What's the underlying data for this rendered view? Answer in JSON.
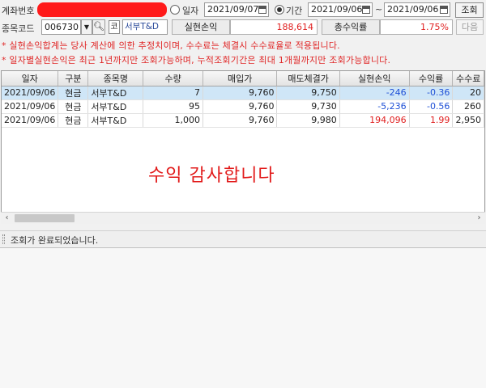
{
  "header": {
    "account_label": "계좌번호",
    "radio_daily_label": "일자",
    "daily_date": "2021/09/07",
    "radio_period_label": "기간",
    "period_from": "2021/09/06",
    "period_sep": "~",
    "period_to": "2021/09/06",
    "query_button": "조회"
  },
  "stock": {
    "code_label": "종목코드",
    "code_value": "006730",
    "market_badge": "코",
    "name_value": "서부T&D",
    "realized_label": "실현손익",
    "realized_value": "188,614",
    "total_return_label": "총수익률",
    "total_return_value": "1.75%",
    "next_button": "다음"
  },
  "notices": [
    "* 실현손익합계는 당사 계산에 의한 추정치이며, 수수료는 체결시 수수료율로 적용됩니다.",
    "* 일자별실현손익은 최근 1년까지만 조회가능하며, 누적조회기간은 최대 1개월까지만 조회가능합니다."
  ],
  "table": {
    "columns": [
      "일자",
      "구분",
      "종목명",
      "수량",
      "매입가",
      "매도체결가",
      "실현손익",
      "수익률",
      "수수료"
    ],
    "rows": [
      [
        "2021/09/06",
        "현금",
        "서부T&D",
        "7",
        "9,760",
        "9,750",
        "-246",
        "-0.36",
        "20"
      ],
      [
        "2021/09/06",
        "현금",
        "서부T&D",
        "95",
        "9,760",
        "9,730",
        "-5,236",
        "-0.56",
        "260"
      ],
      [
        "2021/09/06",
        "현금",
        "서부T&D",
        "1,000",
        "9,760",
        "9,980",
        "194,096",
        "1.99",
        "2,950"
      ]
    ]
  },
  "overlay_message": "수익 감사합니다",
  "status": {
    "text": "조회가 완료되었습니다."
  },
  "colors": {
    "loss": "#1e4fd6",
    "gain": "#e02020",
    "selected_row": "#cfe6f7",
    "redaction": "#ff1a1a"
  }
}
